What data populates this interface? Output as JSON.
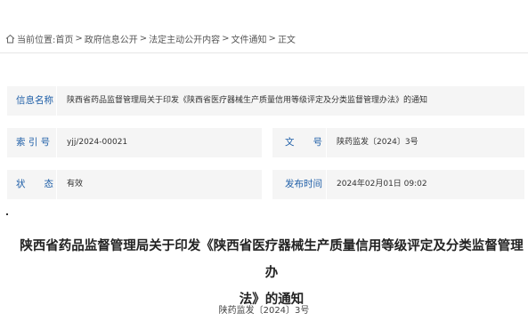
{
  "breadcrumb": {
    "prefix": "当前位置:",
    "items": [
      "首页",
      "政府信息公开",
      "法定主动公开内容",
      "文件通知",
      "正文"
    ],
    "separator": ">"
  },
  "info": {
    "name_label": "信息名称",
    "name_value": "陕西省药品监督管理局关于印发《陕西省医疗器械生产质量信用等级评定及分类监督管理办法》的通知",
    "index_label": "索 引 号",
    "index_value": "yjj/2024-00021",
    "docno_label": "文　　号",
    "docno_value": "陕药监发〔2024〕3号",
    "status_label": "状　　态",
    "status_value": "有效",
    "date_label": "发布时间",
    "date_value": "2024年02月01日 09:02"
  },
  "document": {
    "title_line1": "陕西省药品监督管理局关于印发《陕西省医疗器械生产质量信用等级评定及分类监督管理办",
    "title_line2": "法》的通知",
    "number": "陕药监发〔2024〕3号"
  },
  "colors": {
    "label": "#1f5fa8",
    "cell_bg": "#f5f5f5"
  },
  "icons": {
    "breadcrumb": "home-icon"
  }
}
